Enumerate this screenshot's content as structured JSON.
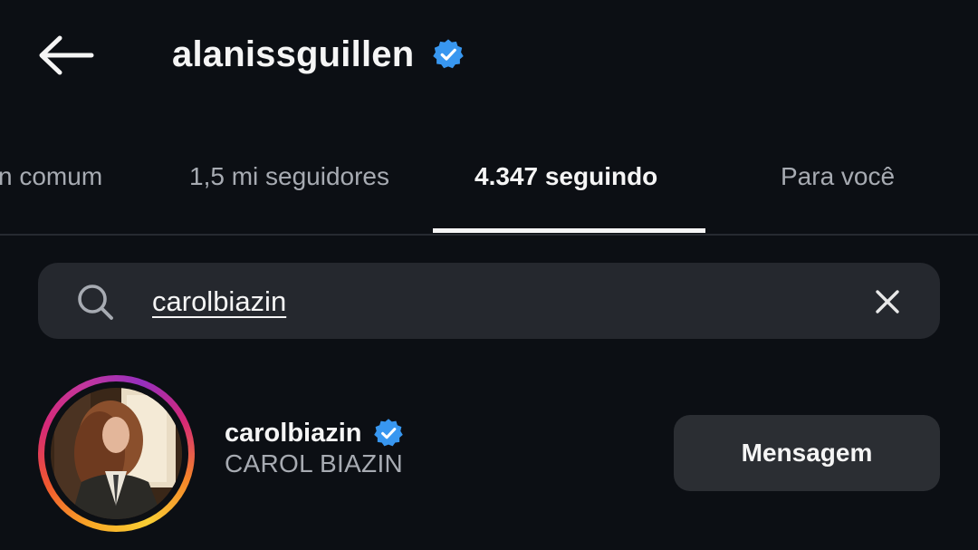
{
  "header": {
    "username": "alanissguillen",
    "verified": true,
    "back_icon": "arrow-left-icon"
  },
  "tabs": [
    {
      "label": "em comum",
      "display": "n comum"
    },
    {
      "label": "1,5 mi seguidores"
    },
    {
      "label": "4.347 seguindo",
      "active": true
    },
    {
      "label": "Para você"
    }
  ],
  "search": {
    "value": "carolbiazin",
    "search_icon": "search-icon",
    "clear_icon": "close-icon"
  },
  "result": {
    "username": "carolbiazin",
    "full_name": "CAROL BIAZIN",
    "verified": true,
    "button_label": "Mensagem",
    "has_story_ring": true
  },
  "colors": {
    "background": "#0c0f14",
    "verified_badge": "#3897f0",
    "search_bg": "#25282e",
    "button_bg": "#2b2e33",
    "muted_text": "#a7abb2"
  }
}
